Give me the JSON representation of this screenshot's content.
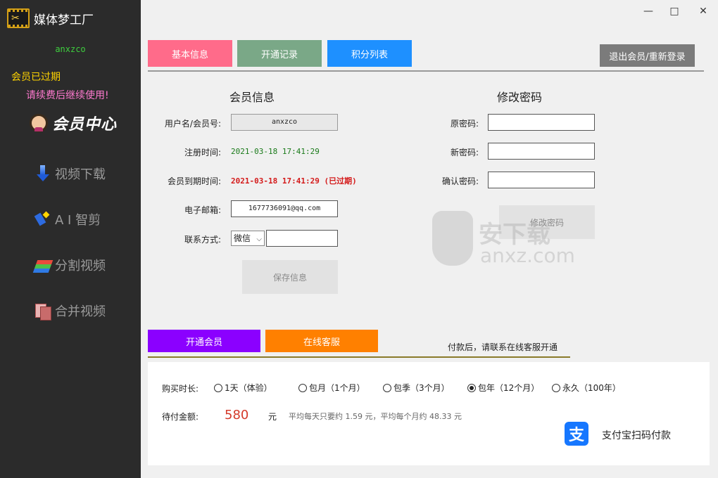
{
  "app": {
    "title": "媒体梦工厂",
    "logo_icon": "film-scissors-icon"
  },
  "sidebar": {
    "username": "anxzco",
    "status": "会员已过期",
    "renew_hint": "请续费后继续使用!",
    "member_center": "会员中心",
    "nav": [
      {
        "label": "视频下载",
        "icon": "download-arrow-icon"
      },
      {
        "label": "A I 智剪",
        "icon": "ai-cut-icon"
      },
      {
        "label": "分割视频",
        "icon": "split-video-icon"
      },
      {
        "label": "合并视频",
        "icon": "merge-video-icon"
      }
    ]
  },
  "window": {
    "minimize": "—",
    "maximize": "□",
    "close": "✕"
  },
  "tabs": [
    {
      "label": "基本信息",
      "color": "#ff6b8a"
    },
    {
      "label": "开通记录",
      "color": "#7aa887"
    },
    {
      "label": "积分列表",
      "color": "#1e90ff"
    }
  ],
  "logout_label": "退出会员/重新登录",
  "member_info": {
    "title": "会员信息",
    "username_label": "用户名/会员号:",
    "username_value": "anxzco",
    "register_label": "注册时间:",
    "register_value": "2021-03-18 17:41:29",
    "expire_label": "会员到期时间:",
    "expire_value": "2021-03-18 17:41:29 (已过期)",
    "email_label": "电子邮箱:",
    "email_value": "1677736091@qq.com",
    "contact_label": "联系方式:",
    "contact_type": "微信",
    "contact_value": "",
    "save_label": "保存信息"
  },
  "password": {
    "title": "修改密码",
    "old_label": "原密码:",
    "new_label": "新密码:",
    "confirm_label": "确认密码:",
    "submit_label": "修改密码"
  },
  "watermark": {
    "cn": "安下载",
    "en": "anxz.com"
  },
  "purchase": {
    "open_label": "开通会员",
    "service_label": "在线客服",
    "note": "付款后，请联系在线客服开通",
    "duration_label": "购买时长:",
    "options": [
      {
        "label": "1天（体验）",
        "selected": false
      },
      {
        "label": "包月（1个月）",
        "selected": false
      },
      {
        "label": "包季（3个月）",
        "selected": false
      },
      {
        "label": "包年（12个月）",
        "selected": true
      },
      {
        "label": "永久（100年）",
        "selected": false
      }
    ],
    "amount_label": "待付金额:",
    "amount": "580",
    "unit": "元",
    "average": "平均每天只要约 1.59 元，平均每个月约 48.33 元",
    "alipay_label": "支付宝扫码付款",
    "alipay_glyph": "支",
    "alipay_color": "#1677ff"
  }
}
